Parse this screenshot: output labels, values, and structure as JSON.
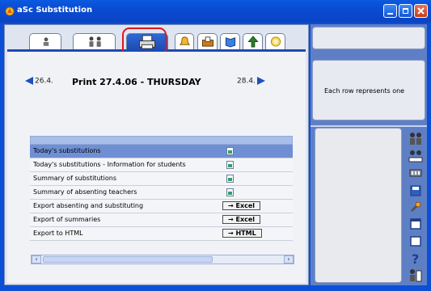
{
  "window": {
    "title": "aSc Substitution"
  },
  "tabs": [
    {
      "name": "tab-teacher",
      "icon": "teacher-icon"
    },
    {
      "name": "tab-classes",
      "icon": "people-icon"
    },
    {
      "name": "tab-print",
      "icon": "printer-icon",
      "active": true
    },
    {
      "name": "tab-bell",
      "icon": "bell-icon"
    },
    {
      "name": "tab-inbox",
      "icon": "inbox-icon"
    },
    {
      "name": "tab-book",
      "icon": "book-icon"
    },
    {
      "name": "tab-up",
      "icon": "arrow-up-icon"
    },
    {
      "name": "tab-sun",
      "icon": "sun-icon"
    }
  ],
  "nav": {
    "prev_label": "26.4.",
    "title": "Print 27.4.06 - THURSDAY",
    "next_label": "28.4."
  },
  "rows": [
    {
      "label": "Today's substitutions",
      "action_type": "icon",
      "selected": true
    },
    {
      "label": "Today's substitutions - Information for students",
      "action_type": "icon"
    },
    {
      "label": "Summary of substitutions",
      "action_type": "icon"
    },
    {
      "label": "Summary of absenting teachers",
      "action_type": "icon"
    },
    {
      "label": "Export absenting and substituting",
      "action_type": "button",
      "action_label": "→ Excel"
    },
    {
      "label": "Export of summaries",
      "action_type": "button",
      "action_label": "→ Excel"
    },
    {
      "label": "Export to HTML",
      "action_type": "button",
      "action_label": "→ HTML"
    }
  ],
  "right_panel": {
    "info_text": "Each row represents one"
  },
  "colors": {
    "titlebar": "#0a4fd6",
    "selection": "#6f8fd4",
    "highlight_box": "#e0161e"
  }
}
